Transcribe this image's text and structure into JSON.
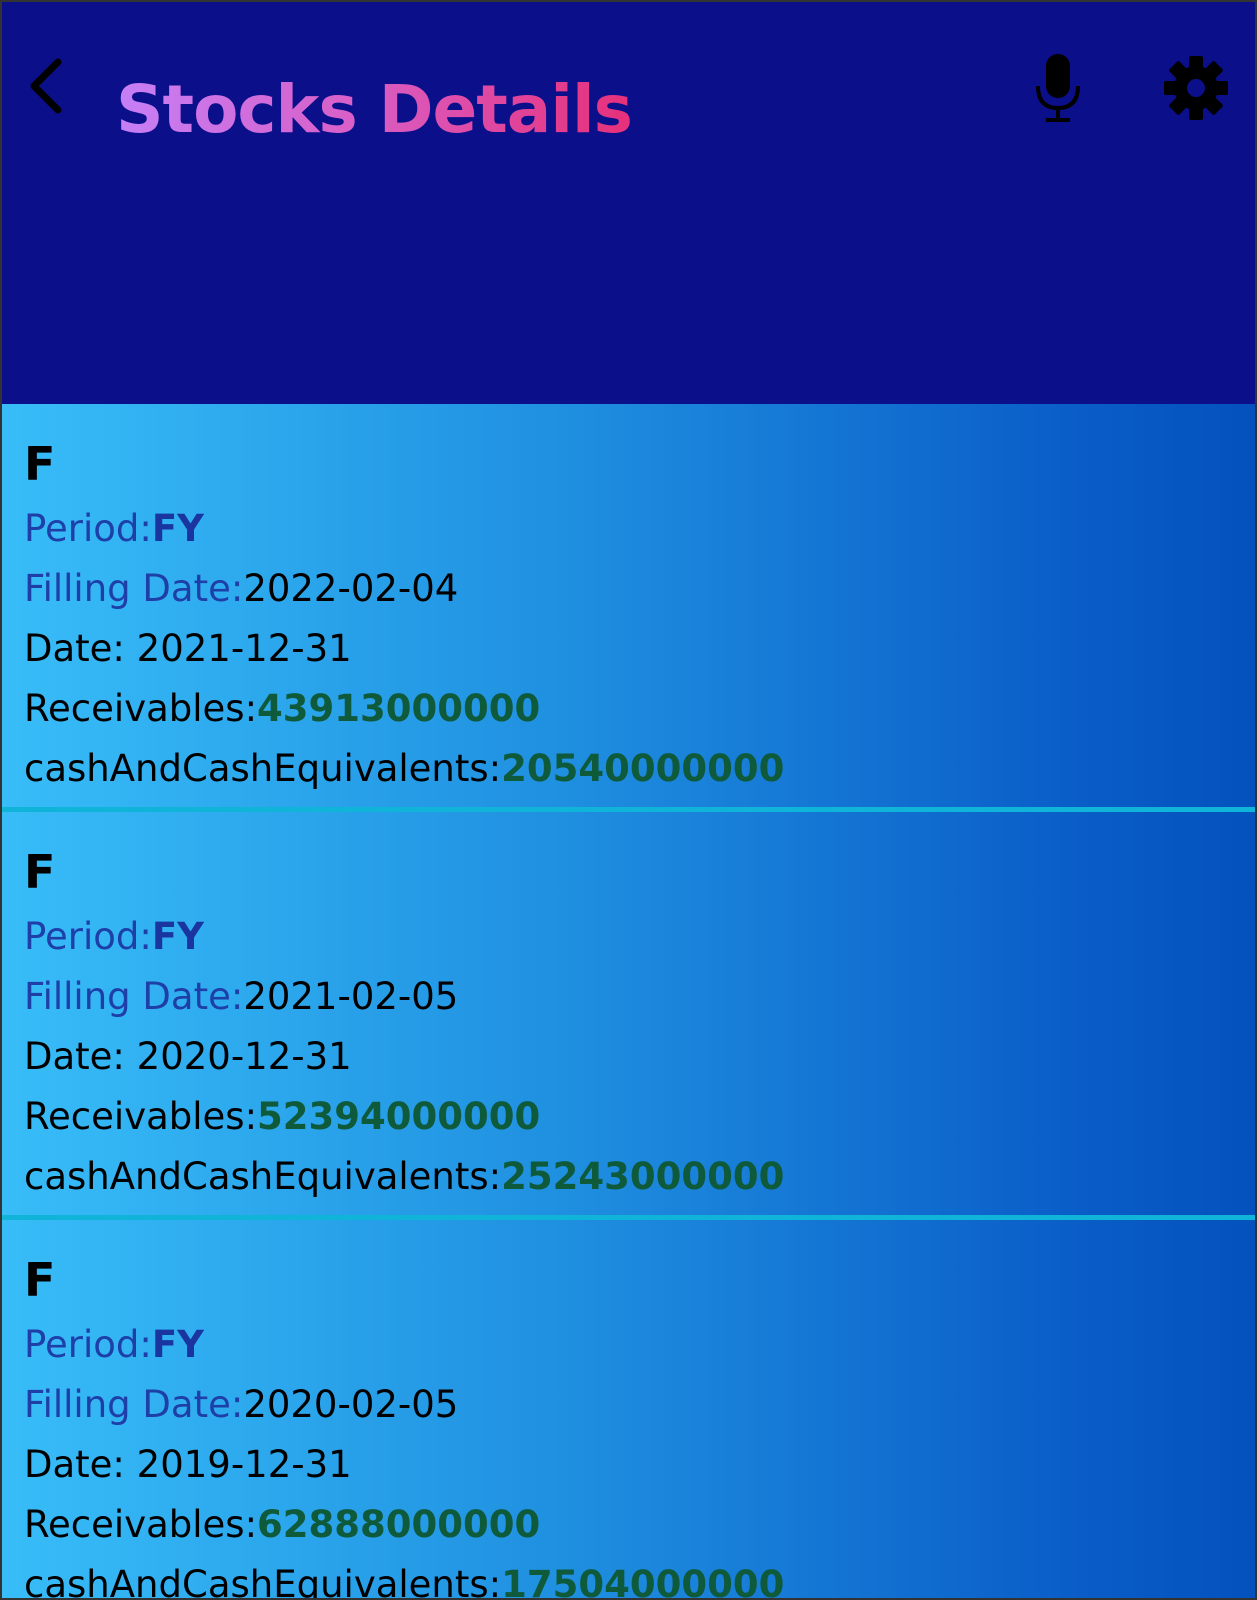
{
  "header": {
    "title": "Stocks Details",
    "icons": {
      "back": "chevron-left-icon",
      "mic": "microphone-icon",
      "settings": "gear-icon"
    },
    "background_color": "#0c0f8a"
  },
  "labels": {
    "period": "Period:",
    "filling_date": "Filling Date:",
    "date": "Date: ",
    "receivables": "Receivables:",
    "cash": "cashAndCashEquivalents:"
  },
  "records": [
    {
      "ticker": "F",
      "period": "FY",
      "filling_date": "2022-02-04",
      "date": "2021-12-31",
      "receivables": "43913000000",
      "cash": "20540000000"
    },
    {
      "ticker": "F",
      "period": "FY",
      "filling_date": "2021-02-05",
      "date": "2020-12-31",
      "receivables": "52394000000",
      "cash": "25243000000"
    },
    {
      "ticker": "F",
      "period": "FY",
      "filling_date": "2020-02-05",
      "date": "2019-12-31",
      "receivables": "62888000000",
      "cash": "17504000000"
    }
  ],
  "colors": {
    "label_blue": "#1e3fa8",
    "value_green": "#0e5a3a",
    "divider": "#10b4d8"
  }
}
